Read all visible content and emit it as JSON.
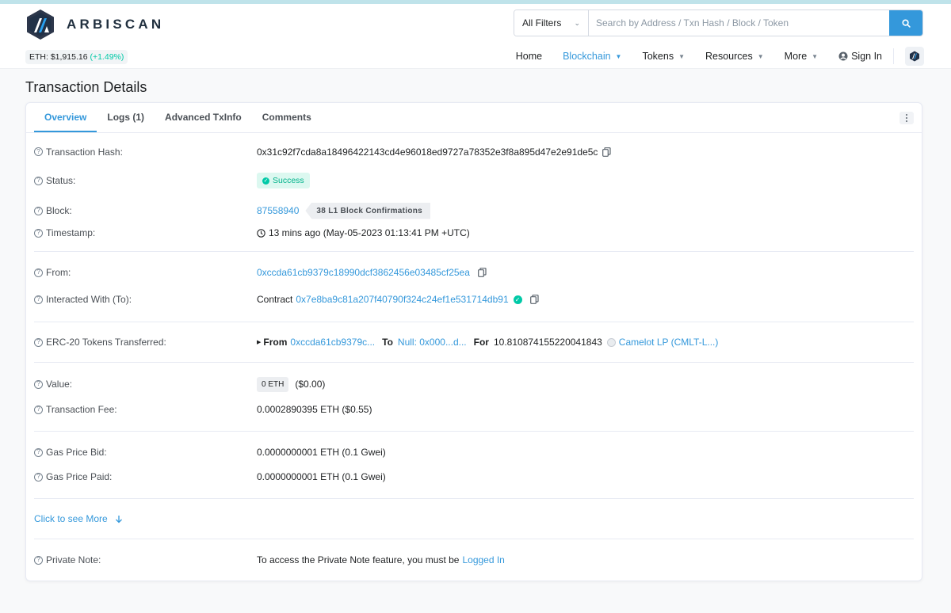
{
  "header": {
    "brand": "ARBISCAN",
    "eth_price_prefix": "ETH: $1,915.16",
    "eth_price_change": "(+1.49%)",
    "filter_label": "All Filters",
    "search_placeholder": "Search by Address / Txn Hash / Block / Token",
    "nav": {
      "home": "Home",
      "blockchain": "Blockchain",
      "tokens": "Tokens",
      "resources": "Resources",
      "more": "More",
      "signin": "Sign In"
    }
  },
  "page_title": "Transaction Details",
  "tabs": {
    "overview": "Overview",
    "logs": "Logs (1)",
    "advanced": "Advanced TxInfo",
    "comments": "Comments"
  },
  "details": {
    "hash_label": "Transaction Hash:",
    "hash": "0x31c92f7cda8a18496422143cd4e96018ed9727a78352e3f8a895d47e2e91de5c",
    "status_label": "Status:",
    "status": "Success",
    "block_label": "Block:",
    "block": "87558940",
    "confirmations": "38 L1 Block Confirmations",
    "timestamp_label": "Timestamp:",
    "timestamp": "13 mins ago (May-05-2023 01:13:41 PM +UTC)",
    "from_label": "From:",
    "from": "0xccda61cb9379c18990dcf3862456e03485cf25ea",
    "to_label": "Interacted With (To):",
    "to_prefix": "Contract",
    "to": "0x7e8ba9c81a207f40790f324c24ef1e531714db91",
    "erc20_label": "ERC-20 Tokens Transferred:",
    "erc20_from_kw": "From",
    "erc20_from": "0xccda61cb9379c...",
    "erc20_to_kw": "To",
    "erc20_to": "Null: 0x000...d...",
    "erc20_for_kw": "For",
    "erc20_amount": "10.810874155220041843",
    "erc20_token": "Camelot LP (CMLT-L...)",
    "value_label": "Value:",
    "value_eth": "0 ETH",
    "value_usd": "($0.00)",
    "fee_label": "Transaction Fee:",
    "fee": "0.0002890395 ETH ($0.55)",
    "gas_bid_label": "Gas Price Bid:",
    "gas_bid": "0.0000000001 ETH (0.1 Gwei)",
    "gas_paid_label": "Gas Price Paid:",
    "gas_paid": "0.0000000001 ETH (0.1 Gwei)",
    "see_more": "Click to see More",
    "note_label": "Private Note:",
    "note_text": "To access the Private Note feature, you must be",
    "note_link": "Logged In"
  }
}
